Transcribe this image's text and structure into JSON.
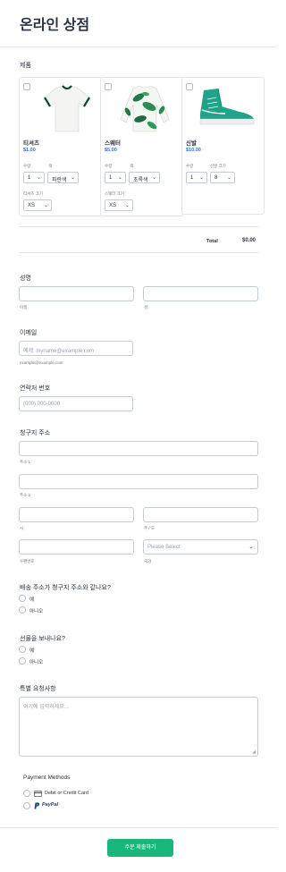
{
  "header": {
    "title": "온라인 상점"
  },
  "products": {
    "label": "제품",
    "items": [
      {
        "name": "티셔츠",
        "price": "$1.00",
        "qty_label": "수량",
        "qty": "1",
        "opt1_label": "색",
        "opt1": "파란색",
        "opt2_label": "티셔츠 크기",
        "opt2": "XS"
      },
      {
        "name": "스웨터",
        "price": "$5.00",
        "qty_label": "수량",
        "qty": "1",
        "opt1_label": "색",
        "opt1": "초록색",
        "opt2_label": "스웨터 크기",
        "opt2": "XS"
      },
      {
        "name": "신발",
        "price": "$10.00",
        "qty_label": "수량",
        "qty": "1",
        "opt1_label": "신발 크기",
        "opt1": "8"
      }
    ],
    "total_label": "Total",
    "total_value": "$0.00"
  },
  "name": {
    "label": "성명",
    "first_sub": "이름",
    "last_sub": "성"
  },
  "email": {
    "label": "이메일",
    "placeholder": "예제: myname@example.com",
    "sub": "example@example.com"
  },
  "phone": {
    "label": "연락처 번호",
    "placeholder": "(000) 000-0000"
  },
  "billing": {
    "label": "청구지 주소",
    "addr1_sub": "주소 1",
    "addr2_sub": "주소 2",
    "city_sub": "시",
    "state_sub": "주 / 도",
    "zip_sub": "우편번호",
    "country_sub": "국가",
    "country_placeholder": "Please Select"
  },
  "shipping_same": {
    "question": "배송 주소가 청구지 주소와 같나요?",
    "yes": "예",
    "no": "아니오"
  },
  "gift": {
    "question": "선물을 보내나요?",
    "yes": "예",
    "no": "아니오"
  },
  "special": {
    "label": "특별 요청사항",
    "placeholder": "여기에 입력하세요..."
  },
  "payment": {
    "label": "Payment Methods",
    "card": "Debit or Credit Card",
    "paypal": "PayPal"
  },
  "submit": {
    "label": "주문 제출하기"
  },
  "colors": {
    "accent": "#18b87a",
    "price": "#2f6fe4"
  }
}
